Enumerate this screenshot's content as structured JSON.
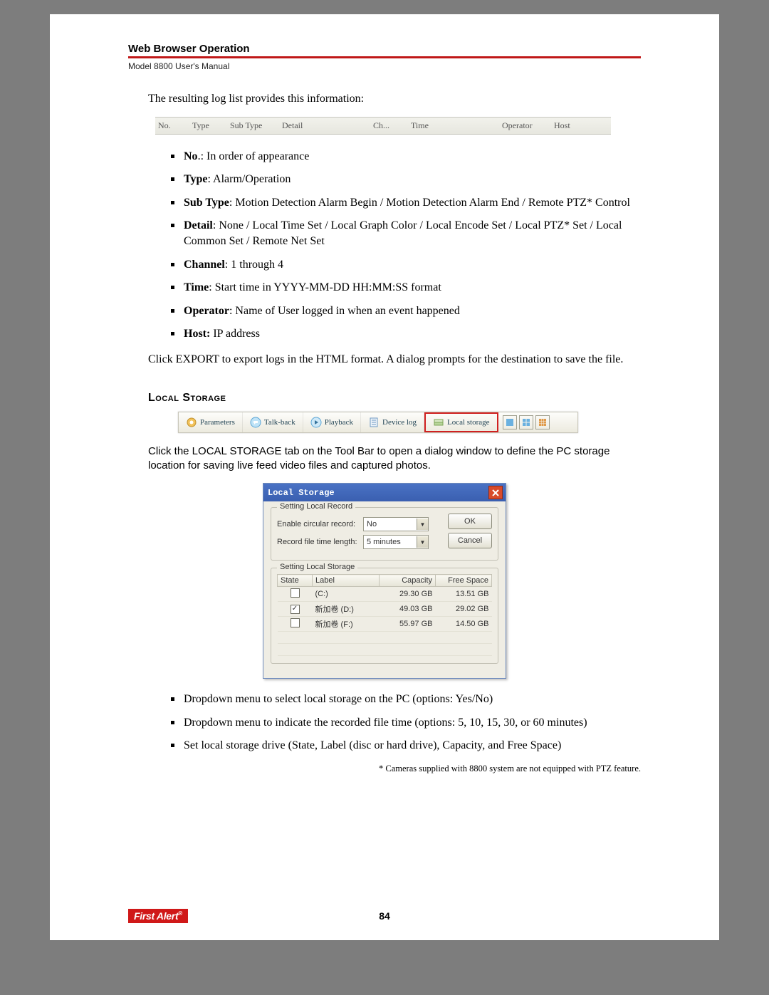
{
  "header": {
    "section": "Web Browser Operation",
    "manual": "Model 8800 User's Manual"
  },
  "intro": "The resulting log list provides this information:",
  "log_columns": {
    "no": "No.",
    "type": "Type",
    "subtype": "Sub Type",
    "detail": "Detail",
    "ch": "Ch...",
    "time": "Time",
    "operator": "Operator",
    "host": "Host"
  },
  "defs": {
    "no": {
      "label": "No",
      "text": ".: In order of appearance"
    },
    "type": {
      "label": "Type",
      "text": ": Alarm/Operation"
    },
    "subtype": {
      "label": "Sub Type",
      "text": ": Motion Detection Alarm Begin / Motion Detection Alarm End / Remote PTZ* Control"
    },
    "detail": {
      "label": "Detail",
      "text": ": None / Local Time Set / Local Graph Color / Local Encode Set / Local PTZ* Set / Local Common Set / Remote Net Set"
    },
    "channel": {
      "label": "Channel",
      "text": ": 1 through 4"
    },
    "time": {
      "label": "Time",
      "text": ": Start time in YYYY-MM-DD HH:MM:SS format"
    },
    "operator": {
      "label": "Operator",
      "text": ": Name of User logged in when an event happened"
    },
    "host": {
      "label": "Host:",
      "text": " IP address"
    }
  },
  "export_para": "Click EXPORT to export logs in the HTML format. A dialog prompts for the destination to save the file.",
  "subheading": "Local Storage",
  "toolbar": {
    "parameters": "Parameters",
    "talkback": "Talk-back",
    "playback": "Playback",
    "devicelog": "Device log",
    "localstorage": "Local storage"
  },
  "ls_para": "Click the LOCAL STORAGE tab on the Tool Bar to open a dialog window to define the PC storage location for saving live feed video files and captured photos.",
  "dialog": {
    "title": "Local Storage",
    "group1": "Setting Local Record",
    "enable_label": "Enable circular record:",
    "enable_value": "No",
    "length_label": "Record file time length:",
    "length_value": "5 minutes",
    "ok": "OK",
    "cancel": "Cancel",
    "group2": "Setting Local Storage",
    "th_state": "State",
    "th_label": "Label",
    "th_capacity": "Capacity",
    "th_free": "Free Space",
    "rows": [
      {
        "checked": "",
        "label": "(C:)",
        "capacity": "29.30 GB",
        "free": "13.51 GB"
      },
      {
        "checked": "✓",
        "label": "新加卷 (D:)",
        "capacity": "49.03 GB",
        "free": "29.02 GB"
      },
      {
        "checked": "",
        "label": "新加卷 (F:)",
        "capacity": "55.97 GB",
        "free": "14.50 GB"
      }
    ]
  },
  "bullets2": {
    "b1": "Dropdown menu to select local storage on the PC (options: Yes/No)",
    "b2": "Dropdown menu to indicate the recorded file time (options: 5, 10, 15, 30, or 60 minutes)",
    "b3": "Set local storage drive (State, Label (disc or hard drive), Capacity, and Free Space)"
  },
  "footnote": "* Cameras supplied with 8800 system are not equipped with PTZ feature.",
  "footer": {
    "logo": "First Alert",
    "page": "84"
  }
}
